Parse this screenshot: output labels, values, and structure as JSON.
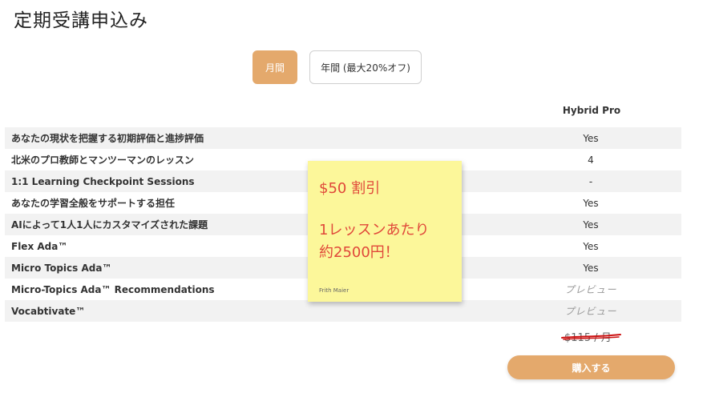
{
  "page": {
    "title": "定期受講申込み"
  },
  "billing_toggle": {
    "monthly_label": "月間",
    "annual_label": "年間 (最大20%オフ)"
  },
  "plan": {
    "name": "Hybrid Pro"
  },
  "features": [
    {
      "name": "あなたの現状を把握する初期評価と進捗評価",
      "value": "Yes"
    },
    {
      "name": "北米のプロ教師とマンツーマンのレッスン",
      "value": "4"
    },
    {
      "name": "1:1 Learning Checkpoint Sessions",
      "value": "-"
    },
    {
      "name": "あなたの学習全般をサポートする担任",
      "value": "Yes"
    },
    {
      "name": "AIによって1人1人にカスタマイズされた課題",
      "value": "Yes"
    },
    {
      "name": "Flex Ada™",
      "value": "Yes"
    },
    {
      "name": "Micro Topics Ada™",
      "value": "Yes"
    },
    {
      "name": "Micro-Topics Ada™ Recommendations",
      "value": "プレビュー"
    },
    {
      "name": "Vocabtivate™",
      "value": "プレビュー"
    }
  ],
  "price": {
    "text": "$115 / 月"
  },
  "buy_button": {
    "label": "購入する"
  },
  "sticky_note": {
    "line1": "$50 割引",
    "line2": "1レッスンあたり",
    "line3": "約2500円！",
    "author": "Frith Maier"
  },
  "colors": {
    "accent": "#e4a96c",
    "note": "#fcf79a",
    "note_text": "#e0483a",
    "strike": "#cc1111"
  }
}
